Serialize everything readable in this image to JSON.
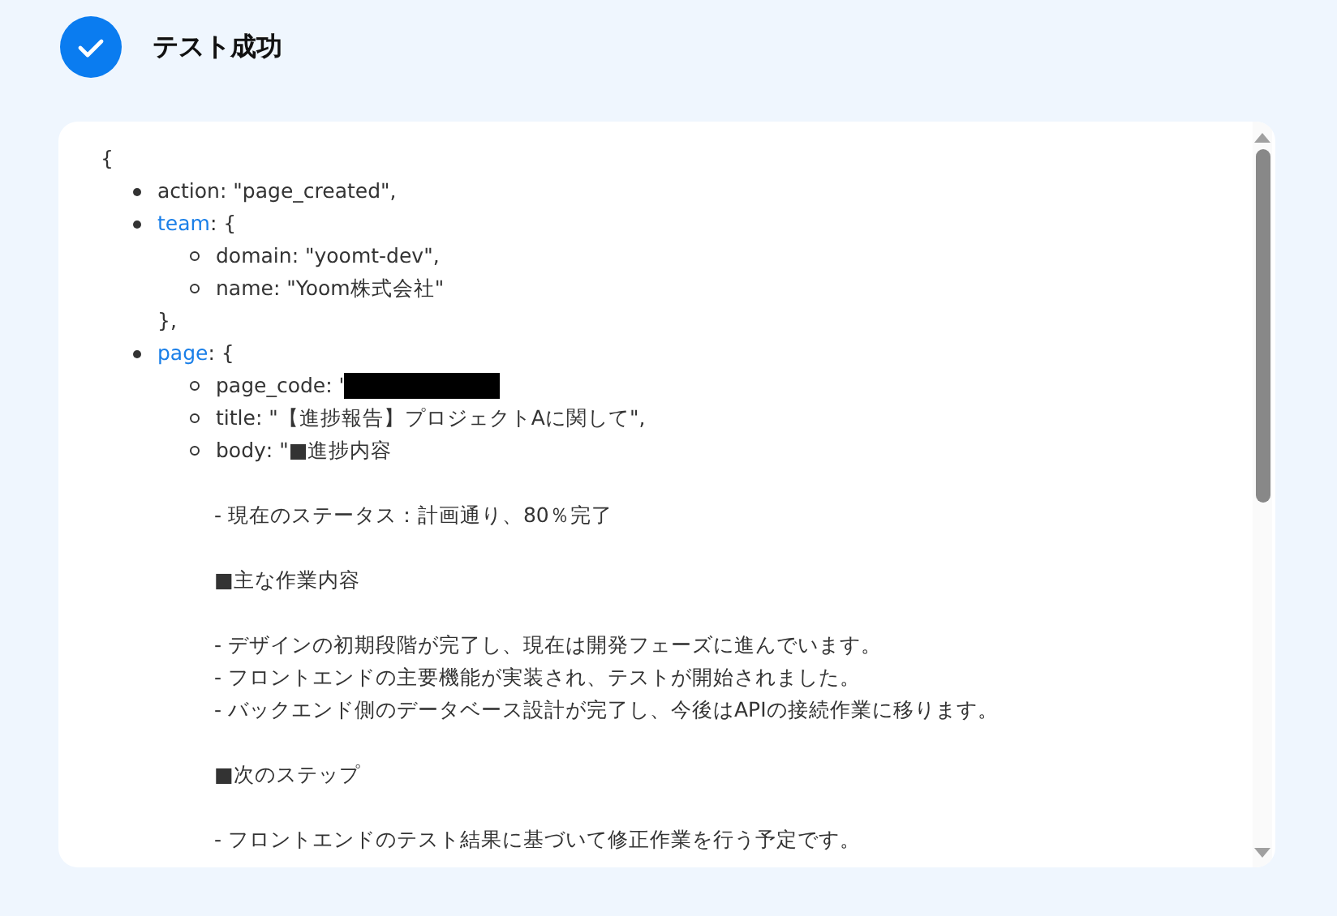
{
  "header": {
    "title": "テスト成功"
  },
  "output": {
    "open": "{",
    "items": [
      {
        "key": "action",
        "rest": ": \"page_created\",",
        "link": false
      },
      {
        "key": "team",
        "rest": ": {",
        "link": true,
        "close": "},",
        "children": [
          {
            "key": "domain",
            "rest": ": \"yoomt-dev\","
          },
          {
            "key": "name",
            "rest": ": \"Yoom株式会社\""
          }
        ]
      },
      {
        "key": "page",
        "rest": ": {",
        "link": true,
        "children": [
          {
            "key": "page_code",
            "rest": ": '",
            "redacted": true
          },
          {
            "key": "title",
            "rest": ": \"【進捗報告】プロジェクトAに関して\","
          },
          {
            "key": "body",
            "rest": ": \"■進捗内容",
            "paragraphs": [
              [
                "- 現在のステータス：計画通り、80％完了"
              ],
              [
                "■主な作業内容"
              ],
              [
                "- デザインの初期段階が完了し、現在は開発フェーズに進んでいます。",
                "- フロントエンドの主要機能が実装され、テストが開始されました。",
                "- バックエンド側のデータベース設計が完了し、今後はAPIの接続作業に移ります。"
              ],
              [
                "■次のステップ"
              ],
              [
                "- フロントエンドのテスト結果に基づいて修正作業を行う予定です。"
              ]
            ]
          }
        ]
      }
    ]
  }
}
